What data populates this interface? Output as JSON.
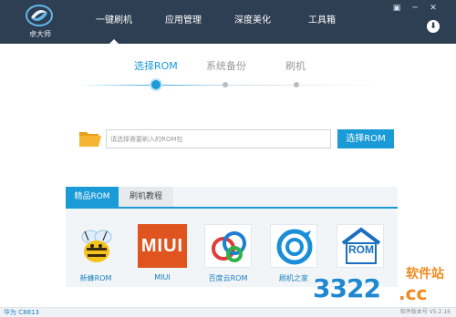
{
  "app": {
    "logo_text": "卓大师"
  },
  "nav": {
    "tabs": [
      {
        "label": "一键刷机"
      },
      {
        "label": "应用管理"
      },
      {
        "label": "深度美化"
      },
      {
        "label": "工具箱"
      }
    ],
    "active_tab": "一键刷机"
  },
  "window_controls": {
    "menu": "▣",
    "minimize": "─",
    "close": "✕"
  },
  "steps": [
    {
      "label": "选择ROM"
    },
    {
      "label": "系统备份"
    },
    {
      "label": "刷机"
    }
  ],
  "rom": {
    "placeholder": "请选择需要刷入的ROM包",
    "select_button": "选择ROM"
  },
  "subtabs": [
    {
      "label": "精品ROM"
    },
    {
      "label": "刷机教程"
    }
  ],
  "cards": [
    {
      "label": "新蜂ROM",
      "icon": "bee-icon"
    },
    {
      "label": "MIUI",
      "icon": "miui-icon"
    },
    {
      "label": "百度云ROM",
      "icon": "baidu-cloud-icon"
    },
    {
      "label": "刷机之家",
      "icon": "flash-home-icon"
    },
    {
      "label": "ROM",
      "icon": "rom-house-icon"
    }
  ],
  "miui_text": "MIUI",
  "rom_icon_text": "ROM",
  "watermark": {
    "number": "3322",
    "cn": "软件站",
    "cc": ".cc"
  },
  "status": {
    "device": "华为 C8813",
    "version": "软件版本号 V5.2.16"
  },
  "colors": {
    "header_bg": "#2e3f53",
    "accent": "#1a9ad6",
    "miui_orange": "#e0541f",
    "watermark_orange": "#f08a1c"
  }
}
